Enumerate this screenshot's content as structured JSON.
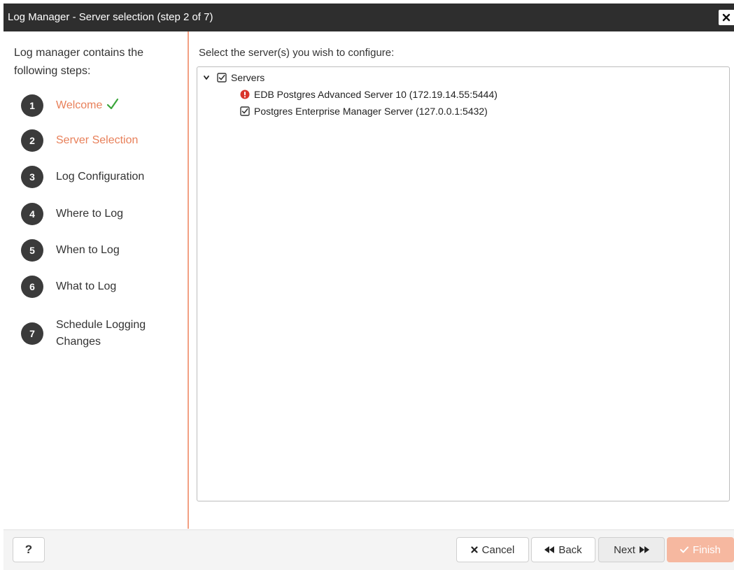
{
  "window": {
    "title": "Log Manager - Server selection (step 2 of 7)",
    "close_icon": "close-icon"
  },
  "sidebar": {
    "intro": "Log manager contains the following steps:",
    "steps": [
      {
        "number": "1",
        "label": "Welcome",
        "done": true
      },
      {
        "number": "2",
        "label": "Server Selection",
        "active": true
      },
      {
        "number": "3",
        "label": "Log Configuration"
      },
      {
        "number": "4",
        "label": "Where to Log"
      },
      {
        "number": "5",
        "label": "When to Log"
      },
      {
        "number": "6",
        "label": "What to Log"
      },
      {
        "number": "7",
        "label": "Schedule Logging Changes"
      }
    ]
  },
  "main": {
    "prompt": "Select the server(s) you wish to configure:",
    "tree": {
      "root": {
        "label": "Servers",
        "checked": true,
        "expanded": true
      },
      "children": [
        {
          "label": "EDB Postgres Advanced Server 10 (172.19.14.55:5444)",
          "status": "error"
        },
        {
          "label": "Postgres Enterprise Manager Server (127.0.0.1:5432)",
          "checked": true
        }
      ]
    }
  },
  "footer": {
    "help_label": "?",
    "cancel_label": "Cancel",
    "back_label": "Back",
    "next_label": "Next",
    "finish_label": "Finish"
  },
  "colors": {
    "accent": "#e8805a",
    "titlebar": "#2e2e2e",
    "step_circle": "#3b3b3b",
    "check_green": "#3aa53a",
    "error_red": "#d9342b",
    "finish_disabled": "#f6b8a0"
  }
}
